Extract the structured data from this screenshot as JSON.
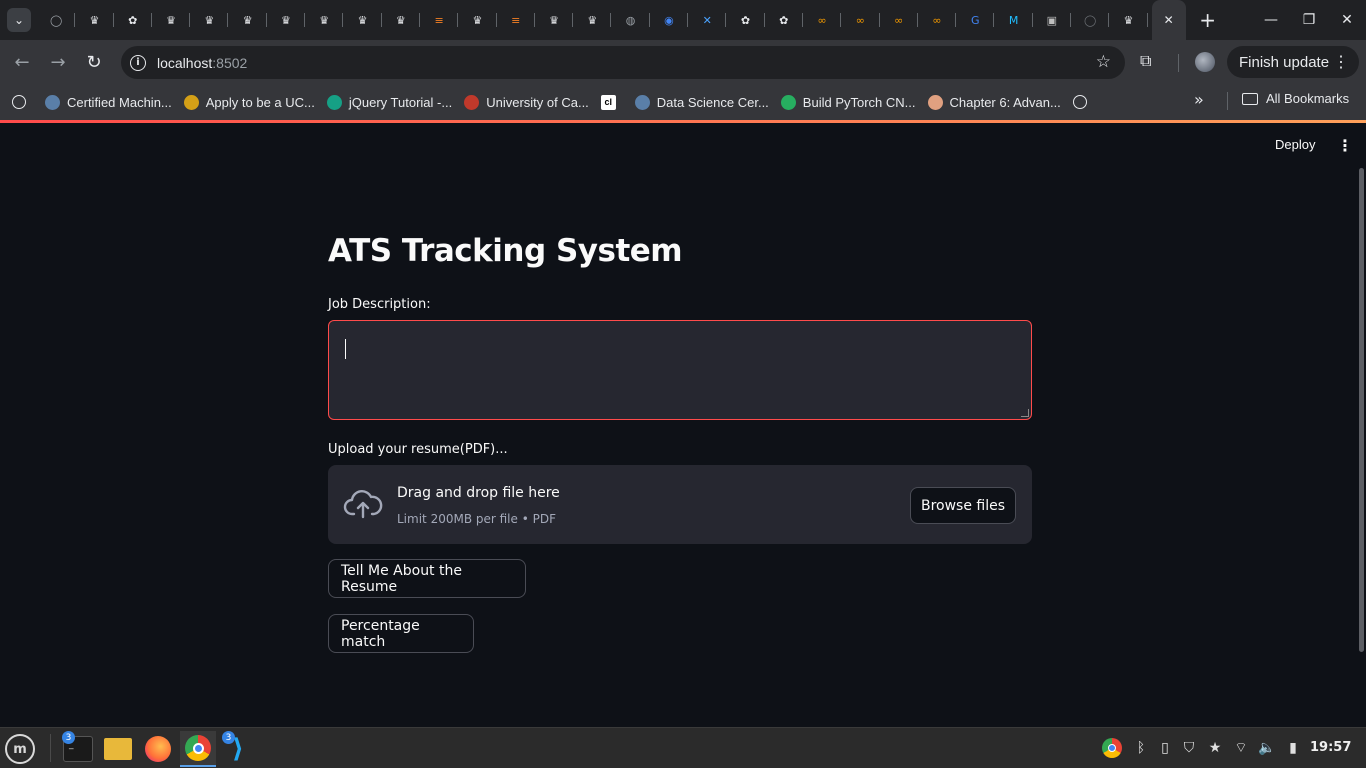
{
  "browser": {
    "tabs": [
      {
        "icon": "github-icon",
        "glyph": "◯",
        "color": "#9aa0a6"
      },
      {
        "icon": "crown-icon",
        "glyph": "♛",
        "color": "#e8eaed"
      },
      {
        "icon": "openai-icon",
        "glyph": "✿",
        "color": "#e8eaed"
      },
      {
        "icon": "crown-icon",
        "glyph": "♛",
        "color": "#e8eaed"
      },
      {
        "icon": "crown-icon",
        "glyph": "♛",
        "color": "#e8eaed"
      },
      {
        "icon": "crown-icon",
        "glyph": "♛",
        "color": "#e8eaed"
      },
      {
        "icon": "crown-icon",
        "glyph": "♛",
        "color": "#e8eaed"
      },
      {
        "icon": "crown-icon",
        "glyph": "♛",
        "color": "#e8eaed"
      },
      {
        "icon": "crown-icon",
        "glyph": "♛",
        "color": "#e8eaed"
      },
      {
        "icon": "crown-icon",
        "glyph": "♛",
        "color": "#e8eaed"
      },
      {
        "icon": "stackoverflow-icon",
        "glyph": "≡",
        "color": "#f48024"
      },
      {
        "icon": "crown-icon",
        "glyph": "♛",
        "color": "#e8eaed"
      },
      {
        "icon": "stackoverflow-icon",
        "glyph": "≡",
        "color": "#f48024"
      },
      {
        "icon": "crown-icon",
        "glyph": "♛",
        "color": "#e8eaed"
      },
      {
        "icon": "crown-icon",
        "glyph": "♛",
        "color": "#e8eaed"
      },
      {
        "icon": "globe-icon",
        "glyph": "◍",
        "color": "#9aa0a6"
      },
      {
        "icon": "circle-blue-icon",
        "glyph": "◉",
        "color": "#4285f4"
      },
      {
        "icon": "butterfly-icon",
        "glyph": "✕",
        "color": "#4aa3ff"
      },
      {
        "icon": "openai-icon",
        "glyph": "✿",
        "color": "#e8eaed"
      },
      {
        "icon": "openai-icon",
        "glyph": "✿",
        "color": "#e8eaed"
      },
      {
        "icon": "infinity-icon",
        "glyph": "∞",
        "color": "#f29900"
      },
      {
        "icon": "infinity-icon",
        "glyph": "∞",
        "color": "#f29900"
      },
      {
        "icon": "infinity-icon",
        "glyph": "∞",
        "color": "#f29900"
      },
      {
        "icon": "infinity-icon",
        "glyph": "∞",
        "color": "#f29900"
      },
      {
        "icon": "google-icon",
        "glyph": "G",
        "color": "#4285f4"
      },
      {
        "icon": "kaggle-icon",
        "glyph": "M",
        "color": "#20beff"
      },
      {
        "icon": "portrait-icon",
        "glyph": "▣",
        "color": "#c0c0c0"
      },
      {
        "icon": "github-icon",
        "glyph": "◯",
        "color": "#6b6f74"
      },
      {
        "icon": "crown-icon",
        "glyph": "♛",
        "color": "#e8eaed"
      }
    ],
    "active_tab_close": "✕",
    "new_tab": "+",
    "url_host": "localhost",
    "url_port": ":8502",
    "finish_update": "Finish update",
    "bookmarks": [
      {
        "label": "Certified Machin...",
        "icon": "globe-icon",
        "color": "#5a7fa8"
      },
      {
        "label": "Apply to be a UC...",
        "icon": "cal-icon",
        "color": "#d4a017"
      },
      {
        "label": "jQuery Tutorial -...",
        "icon": "hexagon-icon",
        "color": "#16a085"
      },
      {
        "label": "University of Ca...",
        "icon": "shield-icon",
        "color": "#c0392b"
      },
      {
        "label": "",
        "icon": "cl-icon",
        "color": "#000000"
      },
      {
        "label": "Data Science Cer...",
        "icon": "globe-icon",
        "color": "#5a7fa8"
      },
      {
        "label": "Build PyTorch CN...",
        "icon": "leaf-icon",
        "color": "#27ae60"
      },
      {
        "label": "Chapter 6: Advan...",
        "icon": "face-icon",
        "color": "#e0a080"
      }
    ],
    "all_bookmarks": "All Bookmarks"
  },
  "app": {
    "deploy": "Deploy",
    "title": "ATS Tracking System",
    "job_description_label": "Job Description:",
    "job_description_value": "",
    "upload_label": "Upload your resume(PDF)...",
    "dropzone_title": "Drag and drop file here",
    "dropzone_sub": "Limit 200MB per file • PDF",
    "browse_button": "Browse files",
    "button_about": "Tell Me About the Resume",
    "button_match": "Percentage match",
    "accent_color": "#ff4b4b"
  },
  "taskbar": {
    "terminal_badge": "3",
    "vscode_badge": "3",
    "clock": "19:57"
  }
}
